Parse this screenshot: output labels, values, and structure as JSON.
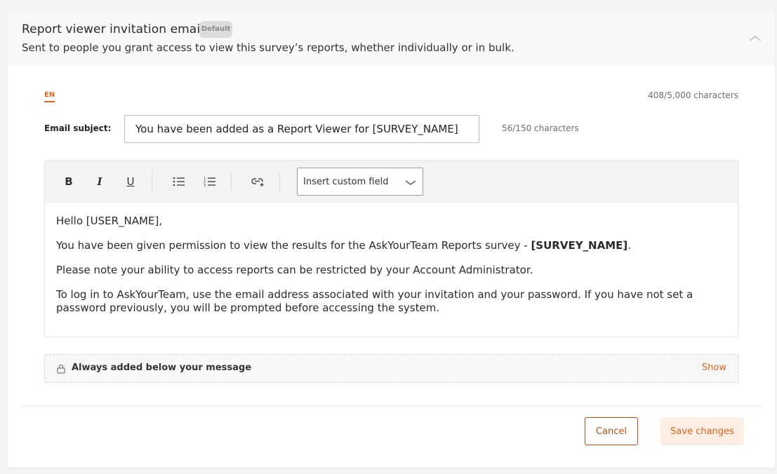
{
  "header": {
    "title": "Report viewer invitation email",
    "badge": "Default",
    "subtitle": "Sent to people you grant access to view this survey’s reports, whether individually or in bulk."
  },
  "language_tab": "EN",
  "body_char_count": "408/5,000 characters",
  "subject": {
    "label": "Email subject:",
    "value": "You have been added as a Report Viewer for [SURVEY_NAME]",
    "char_count": "56/150 characters"
  },
  "toolbar": {
    "bold": "B",
    "italic": "I",
    "underline": "U",
    "custom_field_label": "Insert custom field"
  },
  "email_body": {
    "greeting": "Hello [USER_NAME],",
    "line1_prefix": "You have been given permission to view the results for the AskYourTeam Reports survey - ",
    "line1_bold": "[SURVEY_NAME]",
    "line1_suffix": ".",
    "line2": "Please note your ability to access reports can be restricted by your Account Administrator.",
    "line3": "To log in to AskYourTeam, use the email address associated with your invitation and your password. If you have not set a password previously, you will be prompted before accessing the system."
  },
  "footer_strip": {
    "label": "Always added below your message",
    "show_link": "Show"
  },
  "actions": {
    "cancel": "Cancel",
    "save": "Save changes"
  },
  "colors": {
    "accent": "#e0621a",
    "save_bg": "#fdeee3"
  }
}
